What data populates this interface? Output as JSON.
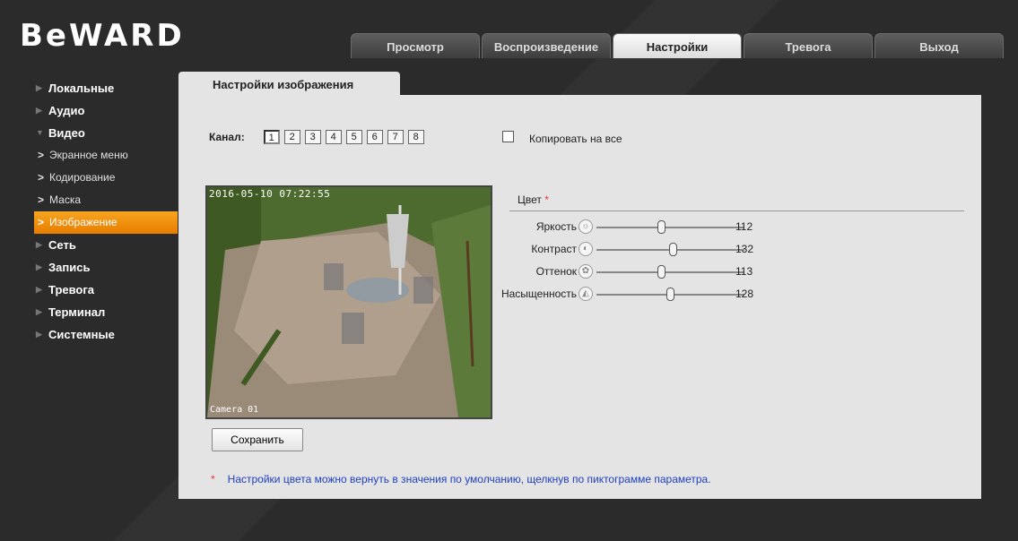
{
  "brand": {
    "logo_text": "BeWARD"
  },
  "nav_tabs": [
    {
      "label": "Просмотр",
      "active": false
    },
    {
      "label": "Воспроизведение",
      "active": false
    },
    {
      "label": "Настройки",
      "active": true
    },
    {
      "label": "Тревога",
      "active": false
    },
    {
      "label": "Выход",
      "active": false
    }
  ],
  "sidebar": {
    "items": [
      {
        "label": "Локальные"
      },
      {
        "label": "Аудио"
      },
      {
        "label": "Видео",
        "expanded": true
      },
      {
        "label": "Экранное меню"
      },
      {
        "label": "Кодирование"
      },
      {
        "label": "Маска"
      },
      {
        "label": "Изображение",
        "active": true
      },
      {
        "label": "Сеть"
      },
      {
        "label": "Запись"
      },
      {
        "label": "Тревога"
      },
      {
        "label": "Терминал"
      },
      {
        "label": "Системные"
      }
    ]
  },
  "panel": {
    "tab_title": "Настройки изображения"
  },
  "channel": {
    "label": "Канал:",
    "buttons": [
      "1",
      "2",
      "3",
      "4",
      "5",
      "6",
      "7",
      "8"
    ],
    "selected": "1",
    "copy_label": "Копировать на все",
    "copy_checked": false
  },
  "video": {
    "timestamp": "2016-05-10 07:22:55",
    "camera_label": "Camera 01"
  },
  "color": {
    "title": "Цвет",
    "star": "*",
    "sliders": [
      {
        "label": "Яркость",
        "icon": "brightness-icon",
        "value": "112",
        "fraction": 0.44
      },
      {
        "label": "Контраст",
        "icon": "contrast-icon",
        "value": "132",
        "fraction": 0.52
      },
      {
        "label": "Оттенок",
        "icon": "hue-icon",
        "value": "113",
        "fraction": 0.44
      },
      {
        "label": "Насыщенность",
        "icon": "saturation-icon",
        "value": "128",
        "fraction": 0.5
      }
    ]
  },
  "buttons": {
    "save_label": "Сохранить"
  },
  "note": {
    "star": "*",
    "text": "Настройки цвета можно вернуть в значения по умолчанию, щелкнув по пиктограмме параметра."
  }
}
